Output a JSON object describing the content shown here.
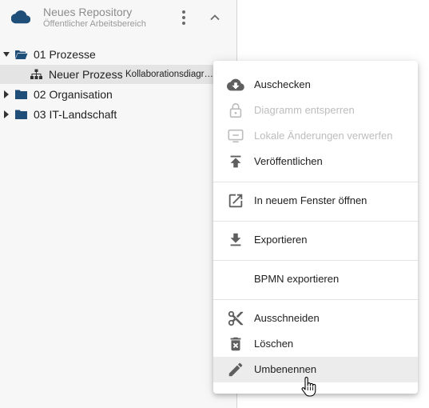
{
  "repository": {
    "title": "Neues Repository",
    "subtitle": "Öffentlicher Arbeitsbereich",
    "icon": "cloud-icon"
  },
  "tree": {
    "folders": [
      {
        "label": "01 Prozesse",
        "expanded": true
      },
      {
        "label": "02 Organisation",
        "expanded": false
      },
      {
        "label": "03 IT-Landschaft",
        "expanded": false
      }
    ],
    "selected_item": {
      "name": "Neuer Prozess",
      "type": "Kollaborationsdiagramm",
      "icon": "hierarchy-icon"
    }
  },
  "context_menu": {
    "items": [
      {
        "label": "Auschecken",
        "icon": "cloud-download-icon",
        "disabled": false
      },
      {
        "label": "Diagramm entsperren",
        "icon": "unlock-icon",
        "disabled": true
      },
      {
        "label": "Lokale Änderungen verwerfen",
        "icon": "discard-icon",
        "disabled": true
      },
      {
        "label": "Veröffentlichen",
        "icon": "publish-icon",
        "disabled": false
      },
      {
        "label": "In neuem Fenster öffnen",
        "icon": "open-new-window-icon",
        "disabled": false
      },
      {
        "label": "Exportieren",
        "icon": "download-icon",
        "disabled": false
      },
      {
        "label": "BPMN exportieren",
        "icon": "",
        "disabled": false
      },
      {
        "label": "Ausschneiden",
        "icon": "scissors-icon",
        "disabled": false
      },
      {
        "label": "Löschen",
        "icon": "trash-icon",
        "disabled": false
      },
      {
        "label": "Umbenennen",
        "icon": "pencil-icon",
        "disabled": false,
        "hovered": true
      }
    ]
  },
  "colors": {
    "accent": "#1f4e79",
    "panel_bg": "#f7f7f7",
    "icon": "#5f5f5f",
    "disabled": "#bdbdbd"
  }
}
